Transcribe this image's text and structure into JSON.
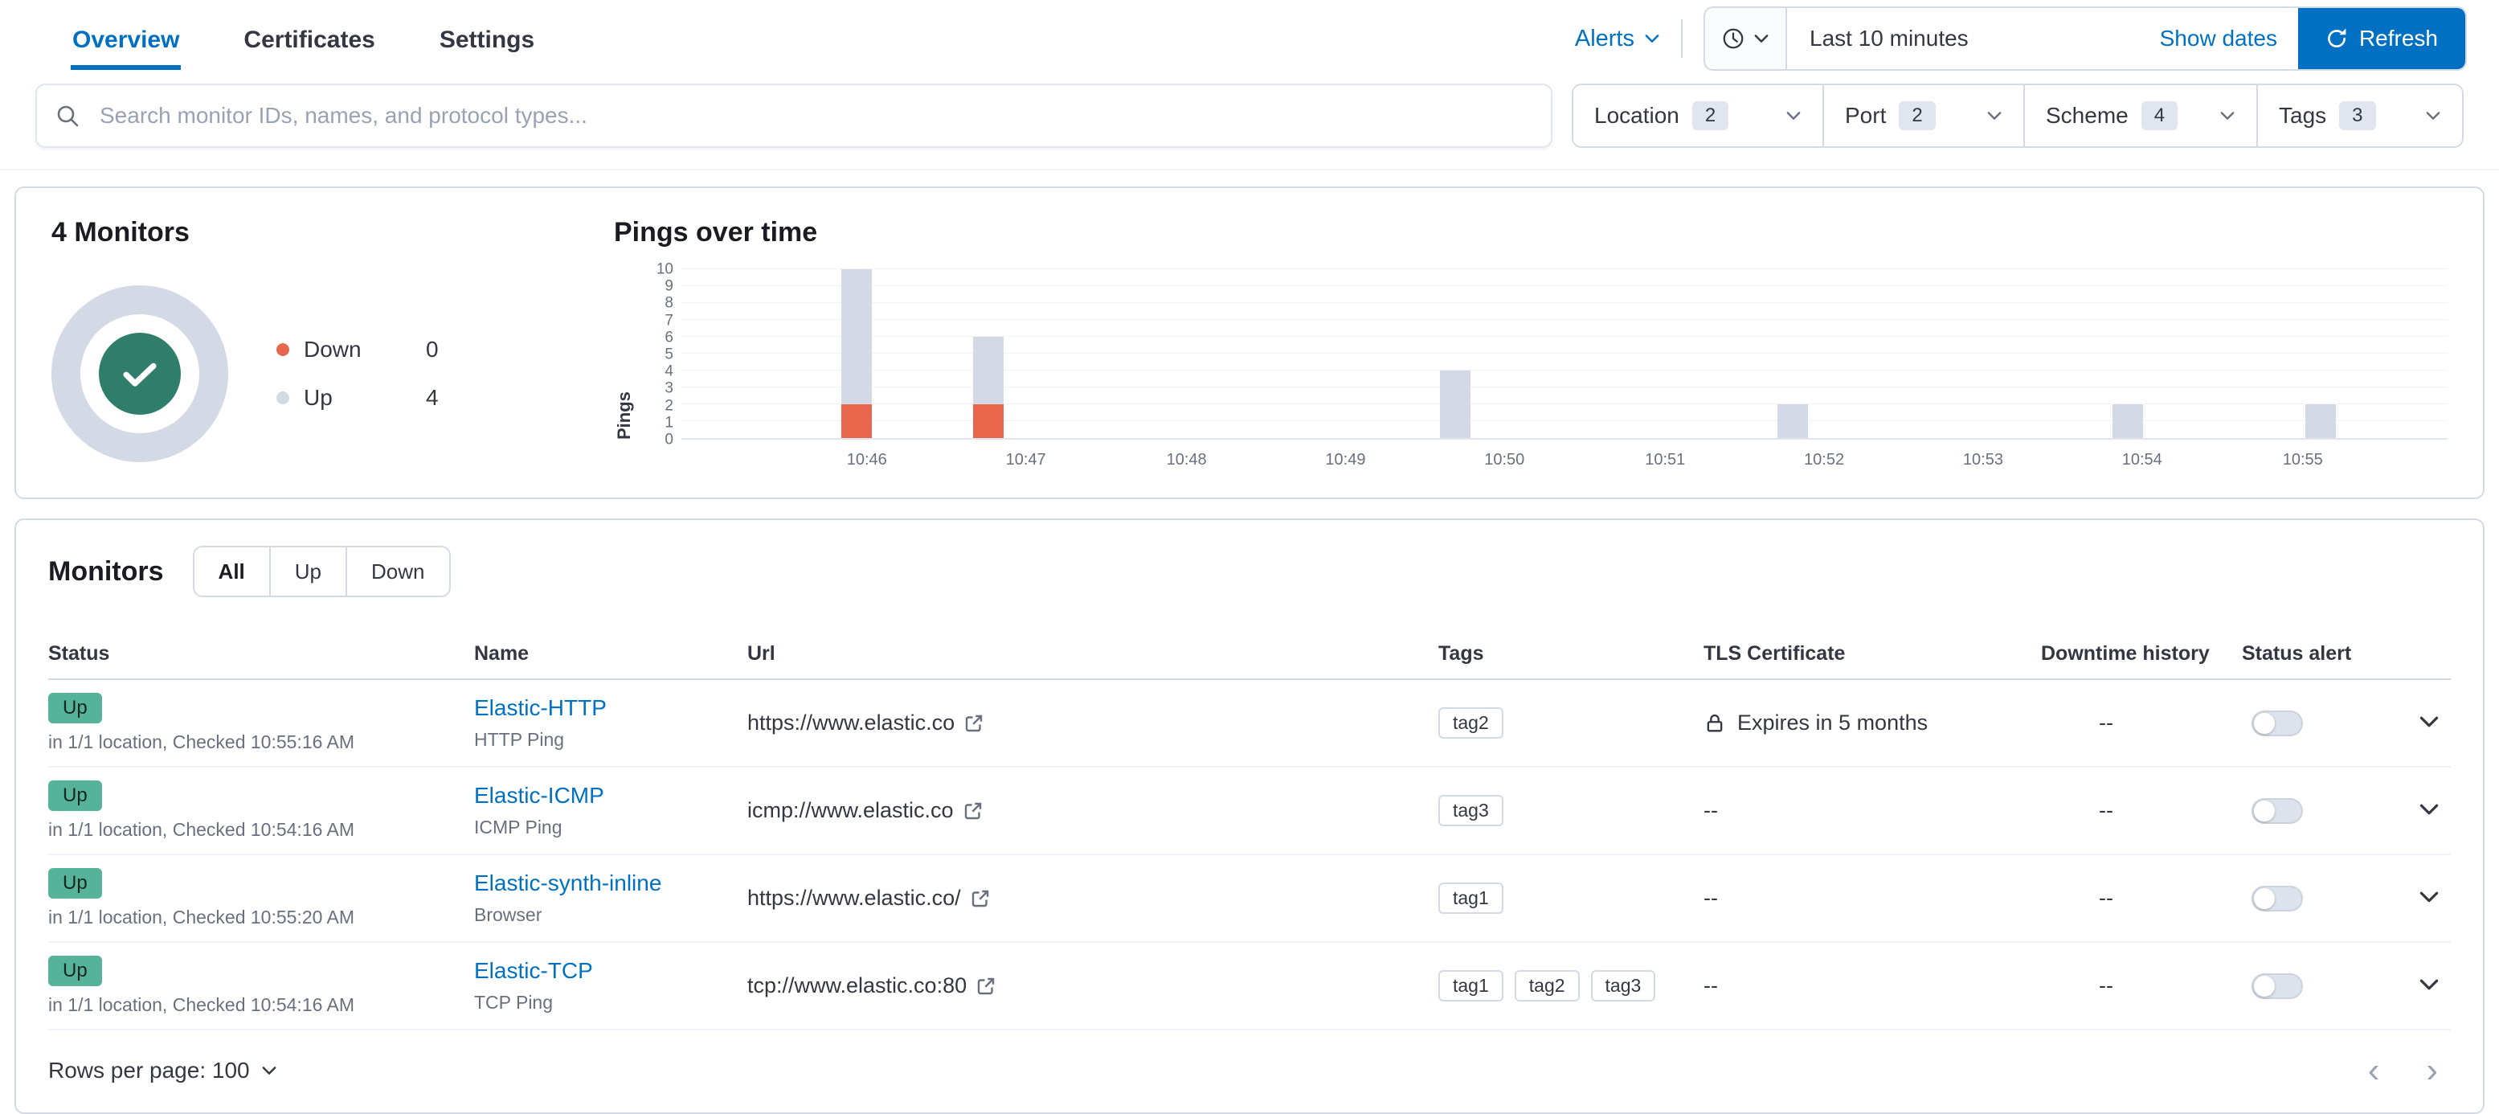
{
  "colors": {
    "primary": "#0071c2",
    "up_badge": "#54b399",
    "down": "#e7664c",
    "up_bar": "#d3dae6",
    "donut_center": "#2f7d6b"
  },
  "header": {
    "tabs": [
      {
        "label": "Overview"
      },
      {
        "label": "Certificates"
      },
      {
        "label": "Settings"
      }
    ],
    "alerts_label": "Alerts",
    "time_range": "Last 10 minutes",
    "show_dates_label": "Show dates",
    "refresh_label": "Refresh"
  },
  "search": {
    "placeholder": "Search monitor IDs, names, and protocol types...",
    "filters": [
      {
        "label": "Location",
        "count": "2"
      },
      {
        "label": "Port",
        "count": "2"
      },
      {
        "label": "Scheme",
        "count": "4"
      },
      {
        "label": "Tags",
        "count": "3"
      }
    ]
  },
  "snapshot": {
    "title": "4 Monitors",
    "legend": [
      {
        "label": "Down",
        "value": "0"
      },
      {
        "label": "Up",
        "value": "4"
      }
    ]
  },
  "chart_data": {
    "type": "bar",
    "title": "Pings over time",
    "ylabel": "Pings",
    "ylim": [
      0,
      10
    ],
    "yticks": [
      0,
      1,
      2,
      3,
      4,
      5,
      6,
      7,
      8,
      9,
      10
    ],
    "xticks": [
      "10:46",
      "10:47",
      "10:48",
      "10:49",
      "10:50",
      "10:51",
      "10:52",
      "10:53",
      "10:54",
      "10:55"
    ],
    "xtick_pos_pct": [
      10.5,
      19.5,
      28.6,
      37.6,
      46.6,
      55.7,
      64.7,
      73.7,
      82.7,
      91.8
    ],
    "series_names": [
      "Down",
      "Up"
    ],
    "bars": [
      {
        "time": "10:46:30",
        "down": 2,
        "up": 8
      },
      {
        "time": "10:47:15",
        "down": 2,
        "up": 4
      },
      {
        "time": "10:50:00",
        "down": 0,
        "up": 4
      },
      {
        "time": "10:52:00",
        "down": 0,
        "up": 2
      },
      {
        "time": "10:54:00",
        "down": 0,
        "up": 2
      },
      {
        "time": "10:55:00",
        "down": 0,
        "up": 2
      }
    ],
    "bar_pos_pct": [
      9.9,
      17.4,
      43.8,
      62.9,
      81.9,
      92.8
    ],
    "grid": true,
    "legend_position": "none"
  },
  "monitors": {
    "title": "Monitors",
    "view_options": [
      "All",
      "Up",
      "Down"
    ],
    "selected_view": "All",
    "columns": [
      "Status",
      "Name",
      "Url",
      "Tags",
      "TLS Certificate",
      "Downtime history",
      "Status alert"
    ],
    "rows": [
      {
        "status": "Up",
        "status_detail": "in 1/1 location, Checked 10:55:16 AM",
        "name": "Elastic-HTTP",
        "monitor_type": "HTTP Ping",
        "url": "https://www.elastic.co",
        "tags": [
          "tag2"
        ],
        "tls": "Expires in 5 months",
        "downtime": "--"
      },
      {
        "status": "Up",
        "status_detail": "in 1/1 location, Checked 10:54:16 AM",
        "name": "Elastic-ICMP",
        "monitor_type": "ICMP Ping",
        "url": "icmp://www.elastic.co",
        "tags": [
          "tag3"
        ],
        "tls": "--",
        "downtime": "--"
      },
      {
        "status": "Up",
        "status_detail": "in 1/1 location, Checked 10:55:20 AM",
        "name": "Elastic-synth-inline",
        "monitor_type": "Browser",
        "url": "https://www.elastic.co/",
        "tags": [
          "tag1"
        ],
        "tls": "--",
        "downtime": "--"
      },
      {
        "status": "Up",
        "status_detail": "in 1/1 location, Checked 10:54:16 AM",
        "name": "Elastic-TCP",
        "monitor_type": "TCP Ping",
        "url": "tcp://www.elastic.co:80",
        "tags": [
          "tag1",
          "tag2",
          "tag3"
        ],
        "tls": "--",
        "downtime": "--"
      }
    ],
    "rows_per_page": "Rows per page: 100",
    "pagination": {
      "prev": "‹",
      "next": "›"
    }
  }
}
